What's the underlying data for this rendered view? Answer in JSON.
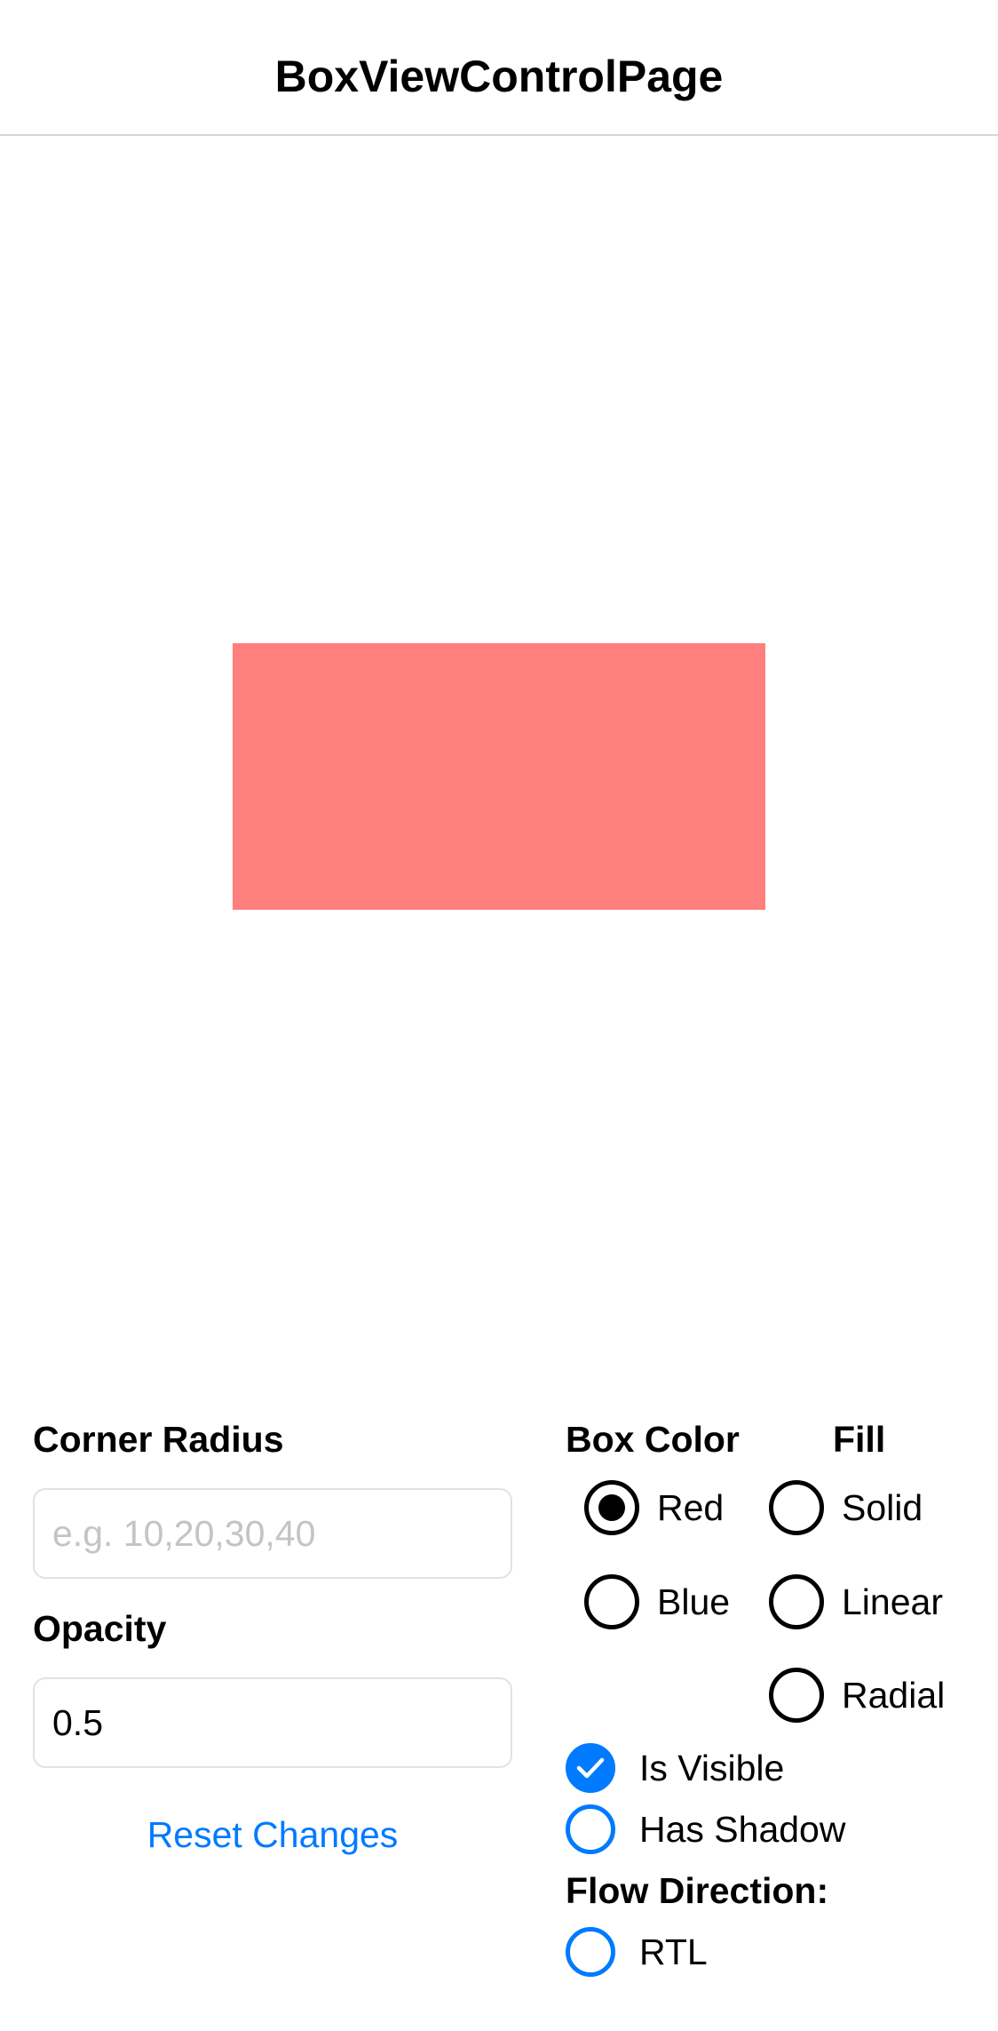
{
  "nav": {
    "title": "BoxViewControlPage"
  },
  "preview": {
    "box_color": "#ff0000",
    "opacity": 0.5
  },
  "corner_radius": {
    "label": "Corner Radius",
    "value": "",
    "placeholder": "e.g. 10,20,30,40"
  },
  "opacity": {
    "label": "Opacity",
    "value": "0.5"
  },
  "reset_button": {
    "label": "Reset Changes"
  },
  "box_color": {
    "label": "Box Color",
    "options": [
      {
        "label": "Red",
        "selected": true
      },
      {
        "label": "Blue",
        "selected": false
      }
    ]
  },
  "fill": {
    "label": "Fill",
    "options": [
      {
        "label": "Solid",
        "selected": false
      },
      {
        "label": "Linear",
        "selected": false
      },
      {
        "label": "Radial",
        "selected": false
      }
    ]
  },
  "toggles": {
    "is_visible": {
      "label": "Is Visible",
      "checked": true
    },
    "has_shadow": {
      "label": "Has Shadow",
      "checked": false
    }
  },
  "flow_direction": {
    "label": "Flow Direction:",
    "rtl": {
      "label": "RTL",
      "checked": false
    }
  },
  "colors": {
    "accent": "#007aff",
    "separator": "#d6d6d6",
    "placeholder_text": "#c4c4c4"
  }
}
